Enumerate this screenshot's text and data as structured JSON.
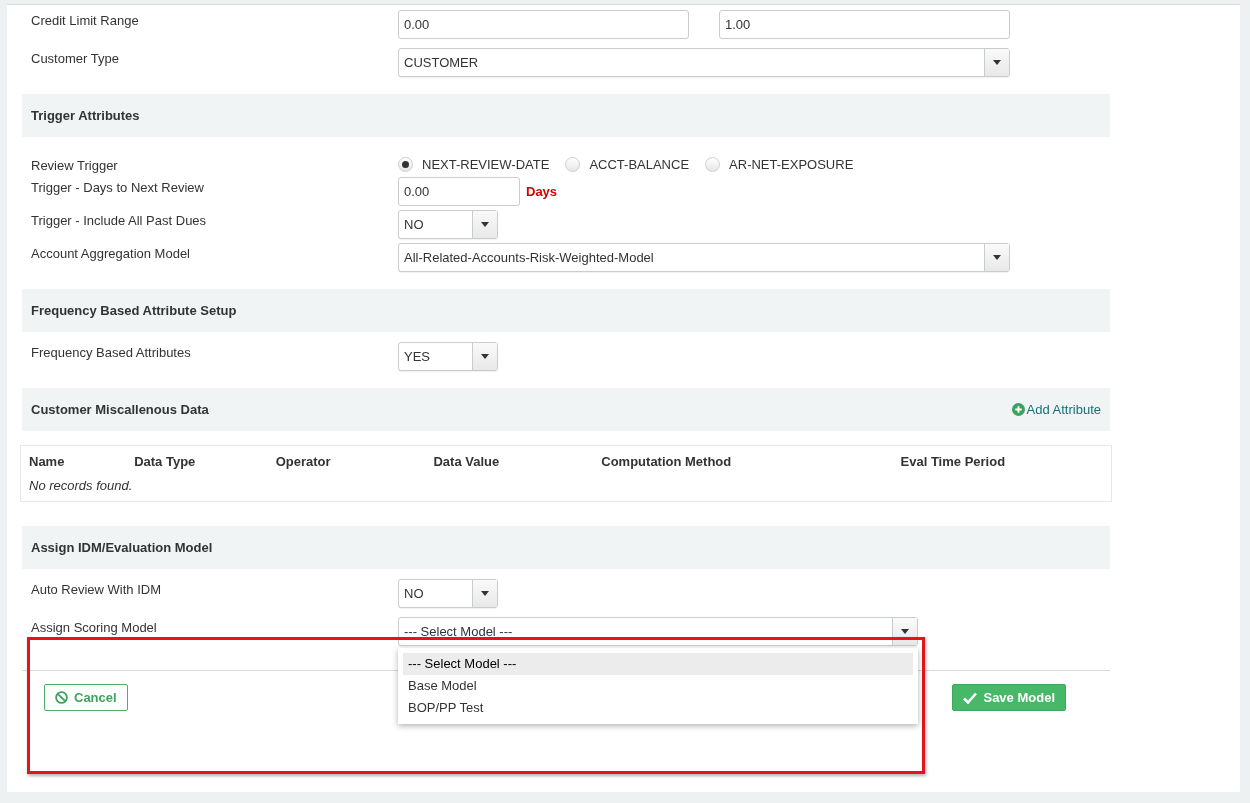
{
  "sections": [
    {
      "rows": [
        {
          "kind": "range",
          "label": "Credit Limit Range",
          "values": [
            "0.00",
            "1.00"
          ]
        },
        {
          "kind": "combo",
          "label": "Customer Type",
          "value": "CUSTOMER"
        }
      ]
    },
    {
      "title": "Trigger Attributes",
      "rows": [
        {
          "kind": "radio",
          "label": "Review Trigger",
          "options": [
            {
              "label": "NEXT-REVIEW-DATE",
              "selected": true
            },
            {
              "label": "ACCT-BALANCE",
              "selected": false
            },
            {
              "label": "AR-NET-EXPOSURE",
              "selected": false
            }
          ]
        },
        {
          "kind": "number",
          "label": "Trigger - Days to Next Review",
          "value": "0.00",
          "unit": "Days"
        },
        {
          "kind": "choice",
          "label": "Trigger - Include All Past Dues",
          "value": "NO"
        },
        {
          "kind": "combo",
          "label": "Account Aggregation Model",
          "value": "All-Related-Accounts-Risk-Weighted-Model"
        }
      ]
    },
    {
      "title": "Frequency Based Attribute Setup",
      "rows": [
        {
          "kind": "choice",
          "label": "Frequency Based Attributes",
          "value": "YES"
        }
      ]
    },
    {
      "title": "Customer Miscallenous Data",
      "action": "Add Attribute",
      "table": {
        "columns": [
          "Name",
          "Data Type",
          "Operator",
          "Data Value",
          "Computation Method",
          "Eval Time Period"
        ],
        "empty": "No records found."
      }
    },
    {
      "title": "Assign IDM/Evaluation Model",
      "rows": [
        {
          "kind": "choice",
          "label": "Auto Review With IDM",
          "value": "NO"
        },
        {
          "kind": "open",
          "label": "Assign Scoring Model",
          "value": "--- Select Model ---",
          "options": [
            {
              "label": "--- Select Model ---",
              "selected": true
            },
            {
              "label": "Base Model",
              "selected": false
            },
            {
              "label": "BOP/PP Test",
              "selected": false
            }
          ]
        }
      ]
    }
  ],
  "buttons": {
    "cancel": "Cancel",
    "save": "Save Model"
  }
}
